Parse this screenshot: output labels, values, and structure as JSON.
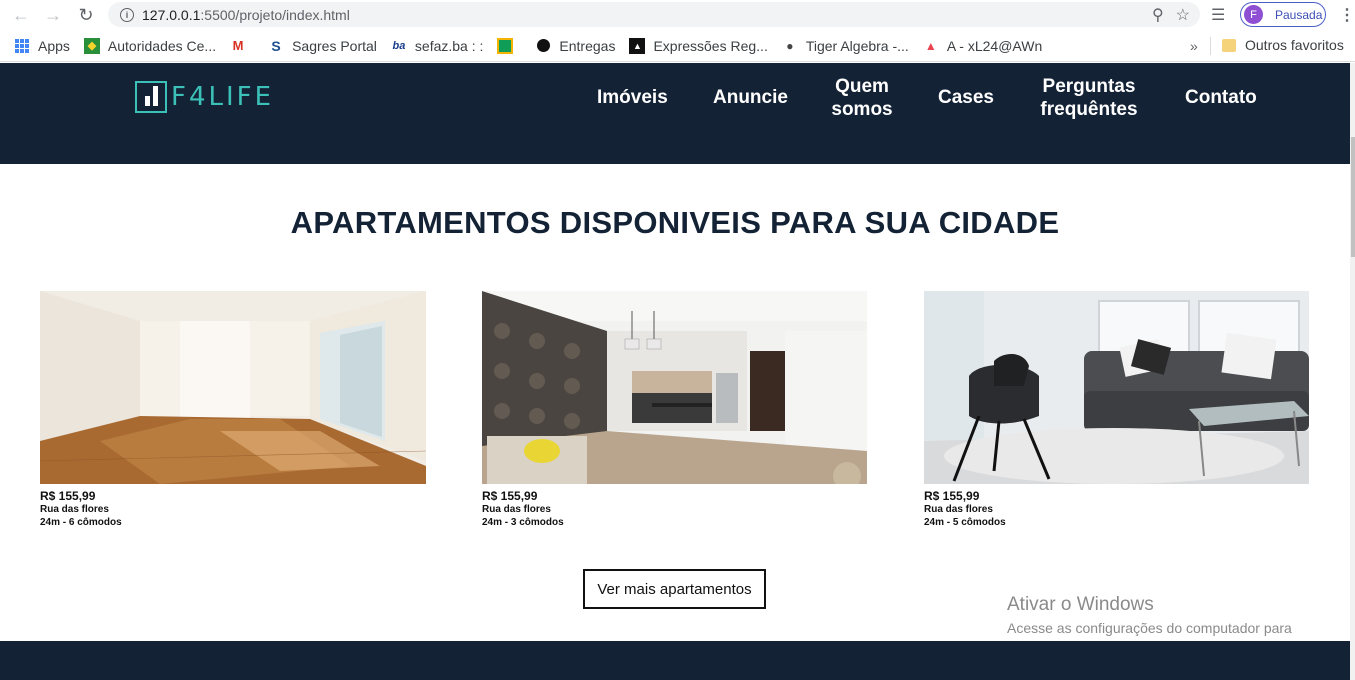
{
  "browser": {
    "url_host": "127.0.0.1",
    "url_path": ":5500/projeto/index.html",
    "profile_initial": "F",
    "profile_status": "Pausada"
  },
  "bookmarks": {
    "items": [
      {
        "label": "Apps",
        "icon": "apps-grid-icon"
      },
      {
        "label": "Autoridades Ce...",
        "icon": "flag-icon"
      },
      {
        "label": "",
        "icon": "gmail-icon"
      },
      {
        "label": "Sagres Portal",
        "icon": "sagres-icon"
      },
      {
        "label": "sefaz.ba : :",
        "icon": "sefaz-icon"
      },
      {
        "label": "",
        "icon": "drive-icon"
      },
      {
        "label": "Entregas",
        "icon": "github-icon"
      },
      {
        "label": "Expressões Reg...",
        "icon": "regex-icon"
      },
      {
        "label": "Tiger Algebra -...",
        "icon": "tiger-icon"
      },
      {
        "label": "A - xL24@AWn",
        "icon": "airtable-icon"
      }
    ],
    "other": "Outros favoritos"
  },
  "site": {
    "logo_text": "F4LIFE",
    "nav": [
      "Imóveis",
      "Anuncie",
      "Quem somos",
      "Cases",
      "Perguntas frequêntes",
      "Contato"
    ],
    "section_title": "APARTAMENTOS DISPONIVEIS PARA SUA CIDADE",
    "cards": [
      {
        "price": "R$ 155,99",
        "street": "Rua das flores",
        "detail": "24m - 6 cômodos"
      },
      {
        "price": "R$ 155,99",
        "street": "Rua das flores",
        "detail": "24m - 3 cômodos"
      },
      {
        "price": "R$ 155,99",
        "street": "Rua das flores",
        "detail": "24m - 5 cômodos"
      }
    ],
    "more_button": "Ver mais apartamentos"
  },
  "watermark": {
    "title": "Ativar o Windows",
    "subtitle": "Acesse as configurações do computador para ativar o Windows."
  },
  "colors": {
    "header_bg": "#132235",
    "accent": "#3cc1b8"
  }
}
